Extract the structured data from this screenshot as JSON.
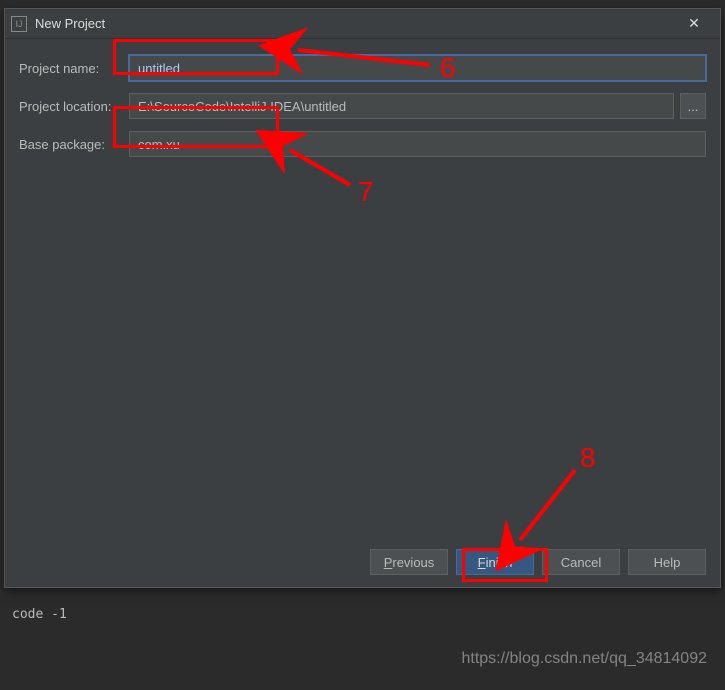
{
  "dialog": {
    "title": "New Project",
    "icon_char": "IJ"
  },
  "fields": {
    "project_name": {
      "label": "Project name:",
      "value": "untitled"
    },
    "project_location": {
      "label": "Project location:",
      "value": "E:\\SourceCode\\IntelliJ IDEA\\untitled",
      "browse": "..."
    },
    "base_package": {
      "label": "Base package:",
      "value": "com.xu"
    }
  },
  "buttons": {
    "previous": "Previous",
    "finish": "Finish",
    "cancel": "Cancel",
    "help": "Help"
  },
  "terminal": "code -1",
  "watermark": "https://blog.csdn.net/qq_34814092",
  "annotations": {
    "label6": "6",
    "label7": "7",
    "label8": "8"
  }
}
